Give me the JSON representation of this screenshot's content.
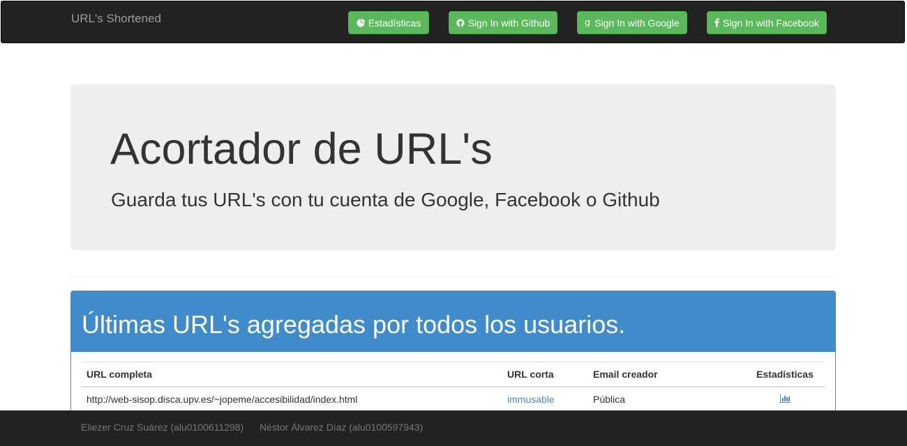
{
  "navbar": {
    "brand": "URL's Shortened",
    "buttons": {
      "stats": "Estadísticas",
      "github": "Sign In with Github",
      "google": "Sign In with Google",
      "facebook": "Sign In with Facebook"
    },
    "button_color": "#5cb85c",
    "background": "#222222"
  },
  "jumbotron": {
    "title": "Acortador de URL's",
    "subtitle": "Guarda tus URL's con tu cuenta de Google, Facebook o Github"
  },
  "panel": {
    "title": "Últimas URL's agregadas por todos los usuarios.",
    "color": "#428bca",
    "table": {
      "headers": {
        "full_url": "URL completa",
        "short_url": "URL corta",
        "email": "Email creador",
        "stats": "Estadísticas"
      },
      "rows": [
        {
          "full_url": "http://web-sisop.disca.upv.es/~jopeme/accesibilidad/index.html",
          "short_url": "immusable",
          "email": "Pública",
          "stats_icon": "bar-chart-icon"
        }
      ]
    }
  },
  "footer": {
    "author1": "Eliezer Cruz Suárez (alu0100611298)",
    "author2": "Néstor Álvarez Díaz (alu0100597943)"
  }
}
